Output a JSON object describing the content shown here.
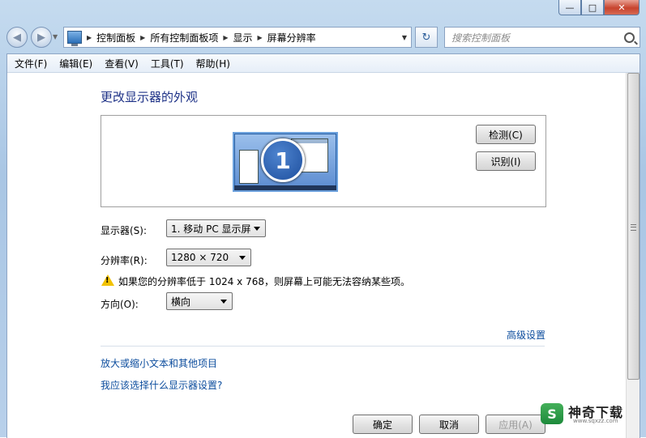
{
  "window": {
    "caption": {
      "minimize": "—",
      "maximize": "□",
      "close": "✕"
    }
  },
  "nav": {
    "back": "◀",
    "forward": "▶",
    "breadcrumb": [
      "控制面板",
      "所有控制面板项",
      "显示",
      "屏幕分辨率"
    ],
    "refresh": "↻",
    "search_placeholder": "搜索控制面板"
  },
  "menu": [
    "文件(F)",
    "编辑(E)",
    "查看(V)",
    "工具(T)",
    "帮助(H)"
  ],
  "main": {
    "title": "更改显示器的外观",
    "monitor_number": "1",
    "detect_button": "检测(C)",
    "identify_button": "识别(I)",
    "display_label": "显示器(S):",
    "display_value": "1. 移动 PC 显示屏",
    "resolution_label": "分辨率(R):",
    "resolution_value": "1280 × 720",
    "warning_text": "如果您的分辨率低于 1024 x 768，则屏幕上可能无法容纳某些项。",
    "orientation_label": "方向(O):",
    "orientation_value": "横向",
    "advanced_link": "高级设置",
    "link_text_size": "放大或缩小文本和其他项目",
    "link_which_settings": "我应该选择什么显示器设置?"
  },
  "footer": {
    "ok": "确定",
    "cancel": "取消",
    "apply": "应用(A)"
  },
  "watermark": {
    "logo": "S",
    "text": "神奇下载",
    "sub": "www.sqxzz.com"
  },
  "colors": {
    "title_blue": "#1e3287",
    "link_blue": "#0b4c9d",
    "warning_yellow": "#f2c200"
  }
}
